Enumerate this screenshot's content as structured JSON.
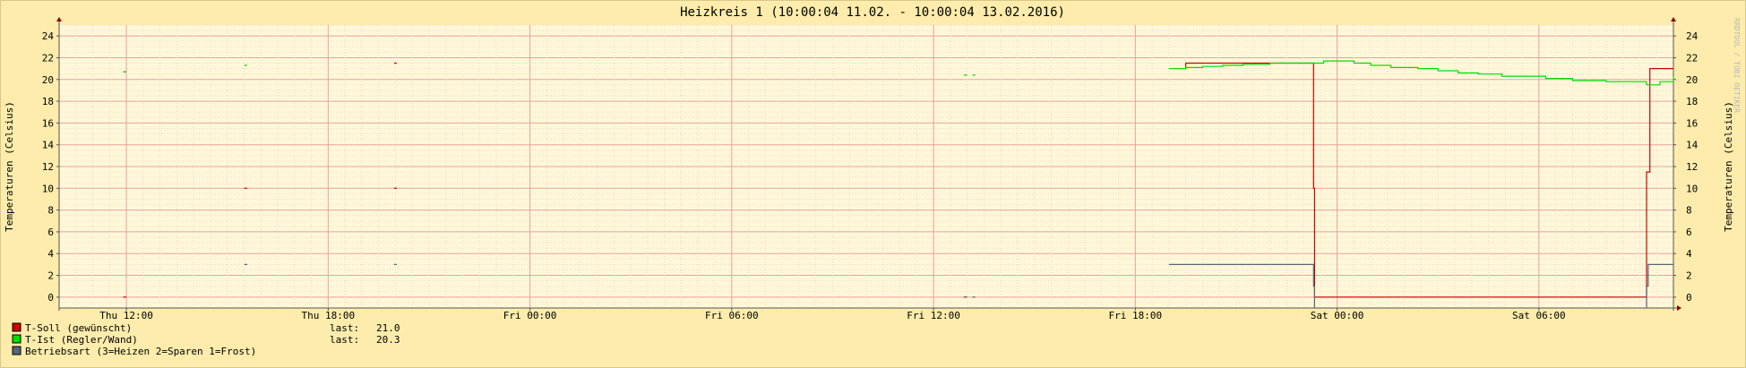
{
  "chart_data": {
    "type": "line",
    "title": "Heizkreis 1 (10:00:04 11.02. - 10:00:04 13.02.2016)",
    "ylabel": "Temperaturen (Celsius)",
    "ylabel_right": "Temperaturen (Celsius)",
    "watermark": "RRDTOOL / TOBI OETIKER",
    "ylim": [
      -1,
      25
    ],
    "xlim": [
      10.0,
      58.0
    ],
    "x_unit": "hours since Thu 00:00",
    "yticks": [
      0,
      2,
      4,
      6,
      8,
      10,
      12,
      14,
      16,
      18,
      20,
      22,
      24
    ],
    "xticks": [
      {
        "x": 12,
        "label": "Thu 12:00"
      },
      {
        "x": 18,
        "label": "Thu 18:00"
      },
      {
        "x": 24,
        "label": "Fri 00:00"
      },
      {
        "x": 30,
        "label": "Fri 06:00"
      },
      {
        "x": 36,
        "label": "Fri 12:00"
      },
      {
        "x": 42,
        "label": "Fri 18:00"
      },
      {
        "x": 48,
        "label": "Sat 00:00"
      },
      {
        "x": 54,
        "label": "Sat 06:00"
      }
    ],
    "grid": true,
    "legend_position": "bottom-left",
    "series": [
      {
        "name": "T-Soll (gewünscht)",
        "color": "#cc0000",
        "last_label": "last:",
        "last": "21.0",
        "segments": [
          [
            [
              11.95,
              20.7
            ]
          ],
          [
            [
              11.95,
              0
            ]
          ],
          [
            [
              15.55,
              10
            ]
          ],
          [
            [
              20.0,
              21.5
            ]
          ],
          [
            [
              20.0,
              10
            ]
          ],
          [
            [
              36.9,
              0
            ],
            [
              37.0,
              0
            ]
          ],
          [
            [
              43.5,
              21.0
            ],
            [
              43.5,
              21.5
            ],
            [
              47.3,
              21.5
            ],
            [
              47.3,
              10
            ],
            [
              47.33,
              10
            ],
            [
              47.33,
              0
            ],
            [
              57.2,
              0
            ],
            [
              57.2,
              11.5
            ],
            [
              57.3,
              11.5
            ],
            [
              57.3,
              21.0
            ],
            [
              58.0,
              21.0
            ]
          ]
        ]
      },
      {
        "name": "T-Ist  (Regler/Wand)",
        "color": "#00dd00",
        "last_label": "last:",
        "last": "20.3",
        "segments": [
          [
            [
              11.95,
              20.7
            ]
          ],
          [
            [
              15.55,
              21.3
            ]
          ],
          [
            [
              36.9,
              20.4
            ],
            [
              37.0,
              20.4
            ]
          ],
          [
            [
              37.2,
              20.4
            ]
          ],
          [
            [
              43.0,
              21.0
            ],
            [
              43.5,
              21.0
            ],
            [
              43.5,
              21.1
            ],
            [
              44.0,
              21.1
            ],
            [
              44.0,
              21.2
            ],
            [
              44.6,
              21.2
            ],
            [
              44.6,
              21.3
            ],
            [
              45.2,
              21.3
            ],
            [
              45.2,
              21.4
            ],
            [
              46.0,
              21.4
            ],
            [
              46.0,
              21.5
            ],
            [
              47.6,
              21.5
            ],
            [
              47.6,
              21.7
            ],
            [
              48.5,
              21.7
            ],
            [
              48.5,
              21.5
            ],
            [
              49.0,
              21.5
            ],
            [
              49.0,
              21.3
            ],
            [
              49.6,
              21.3
            ],
            [
              49.6,
              21.1
            ],
            [
              50.4,
              21.1
            ],
            [
              50.4,
              21.0
            ],
            [
              51.0,
              21.0
            ],
            [
              51.0,
              20.8
            ],
            [
              51.6,
              20.8
            ],
            [
              51.6,
              20.6
            ],
            [
              52.2,
              20.6
            ],
            [
              52.2,
              20.5
            ],
            [
              52.9,
              20.5
            ],
            [
              52.9,
              20.3
            ],
            [
              54.2,
              20.3
            ],
            [
              54.2,
              20.1
            ],
            [
              55.0,
              20.1
            ],
            [
              55.0,
              19.9
            ],
            [
              56.0,
              19.9
            ],
            [
              56.0,
              19.8
            ],
            [
              57.2,
              19.8
            ],
            [
              57.2,
              19.5
            ],
            [
              57.6,
              19.5
            ],
            [
              57.6,
              19.8
            ],
            [
              58.0,
              19.8
            ],
            [
              58.0,
              20.3
            ]
          ]
        ]
      },
      {
        "name": "Betriebsart (3=Heizen 2=Sparen 1=Frost)",
        "color": "#556677",
        "last_label": "",
        "last": "",
        "segments": [
          [
            [
              15.55,
              3
            ]
          ],
          [
            [
              20.0,
              3
            ]
          ],
          [
            [
              36.9,
              0
            ],
            [
              37.0,
              0
            ]
          ],
          [
            [
              37.2,
              0
            ]
          ],
          [
            [
              43.0,
              3
            ],
            [
              47.3,
              3
            ],
            [
              47.3,
              1
            ],
            [
              47.33,
              1
            ],
            [
              47.33,
              -1
            ]
          ],
          [
            [
              57.2,
              -1
            ],
            [
              57.2,
              1
            ],
            [
              57.25,
              1
            ],
            [
              57.25,
              3
            ],
            [
              58.0,
              3
            ]
          ]
        ]
      }
    ]
  }
}
